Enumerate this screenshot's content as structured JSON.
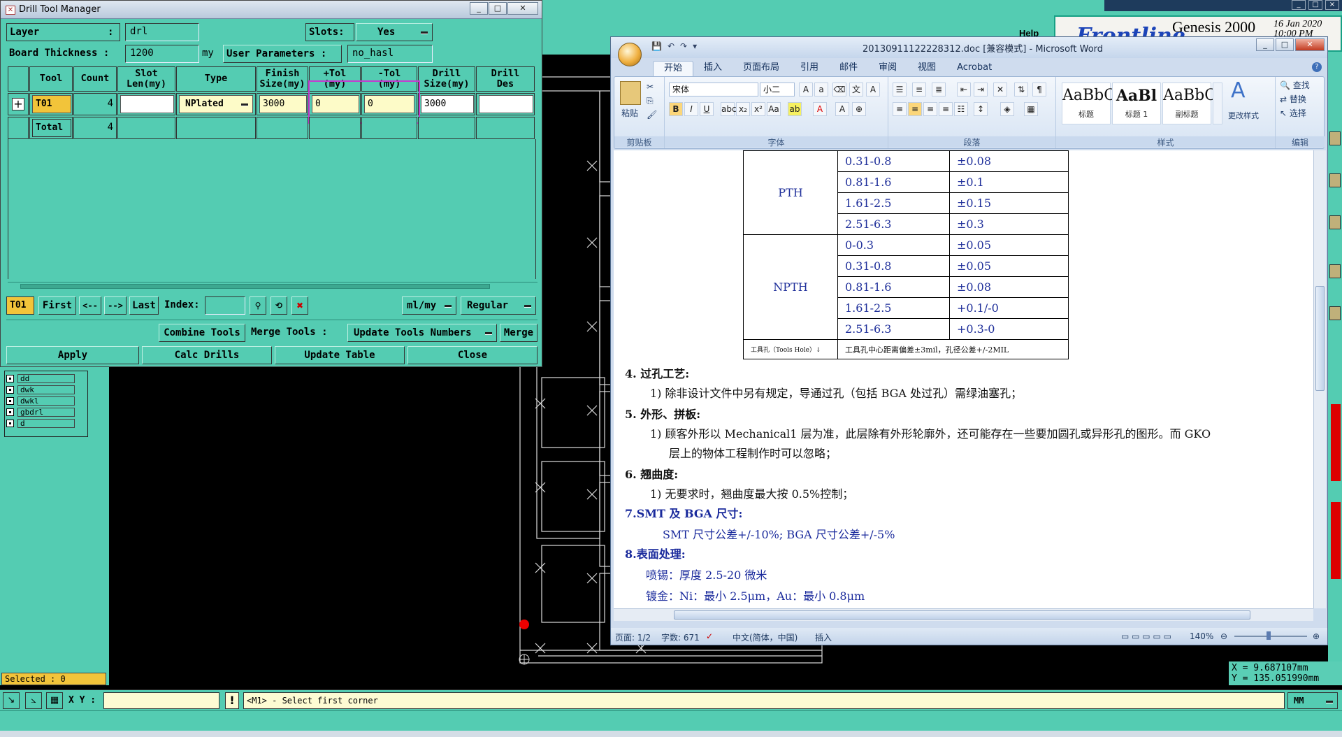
{
  "drill_tool_manager": {
    "title": "Drill Tool Manager",
    "layer_label": "Layer",
    "layer_colon": ":",
    "layer_value": "drl",
    "slots_label": "Slots:",
    "slots_value": "Yes",
    "board_thickness_label": "Board Thickness :",
    "board_thickness_value": "1200",
    "board_thickness_unit": "my",
    "user_params_label": "User Parameters :",
    "user_params_value": "no_hasl",
    "columns": [
      "Tool",
      "Count",
      "Slot\nLen(my)",
      "Type",
      "Finish\nSize(my)",
      "+Tol\n(my)",
      "-Tol\n(my)",
      "Drill\nSize(my)",
      "Drill\nDes"
    ],
    "rows": [
      {
        "tool": "T01",
        "count": "4",
        "slot_len": "",
        "type": "NPlated",
        "finish_size": "3000",
        "plus_tol": "0",
        "minus_tol": "0",
        "drill_size": "3000",
        "drill_des": ""
      }
    ],
    "total_label": "Total",
    "total_count": "4",
    "nav": {
      "current_tool": "T01",
      "first": "First",
      "prev": "<--",
      "next": "-->",
      "last": "Last",
      "index_label": "Index:",
      "unit_select": "ml/my",
      "mode_select": "Regular"
    },
    "actions": {
      "combine_tools": "Combine Tools",
      "merge_tools": "Merge Tools :",
      "update_tools_numbers": "Update Tools Numbers",
      "merge": "Merge",
      "apply": "Apply",
      "calc_drills": "Calc Drills",
      "update_table": "Update Table",
      "close": "Close"
    }
  },
  "genesis": {
    "brand": "Frontline",
    "product": "Genesis 2000",
    "date": "16 Jan 2020",
    "time": "10:00 PM",
    "help": "Help",
    "layers": [
      "dd",
      "dwk",
      "dwkl",
      "gbdrl",
      "d"
    ],
    "selected": "Selected : 0",
    "coord_x": "X = 9.687107mm",
    "coord_y": "Y = 135.051990mm",
    "xy_label": "X Y :",
    "prompt": "<M1> - Select first corner",
    "units": "MM"
  },
  "word": {
    "title": "20130911122228312.doc [兼容模式] - Microsoft Word",
    "tabs": [
      "开始",
      "插入",
      "页面布局",
      "引用",
      "邮件",
      "审阅",
      "视图",
      "Acrobat"
    ],
    "clipboard": {
      "paste": "粘贴",
      "group": "剪贴板"
    },
    "font": {
      "name": "宋体",
      "size": "小二",
      "group": "字体"
    },
    "paragraph_group": "段落",
    "styles": [
      {
        "preview": "AaBbC",
        "name": "标题"
      },
      {
        "preview": "AaBl",
        "name": "标题 1"
      },
      {
        "preview": "AaBbC",
        "name": "副标题"
      }
    ],
    "change_styles": "更改样式",
    "styles_group": "样式",
    "editing": {
      "find": "查找",
      "replace": "替换",
      "select": "选择",
      "group": "编辑"
    },
    "table": {
      "pth_label": "PTH",
      "pth_rows": [
        [
          "0.31-0.8",
          "±0.08"
        ],
        [
          "0.81-1.6",
          "±0.1"
        ],
        [
          "1.61-2.5",
          "±0.15"
        ],
        [
          "2.51-6.3",
          "±0.3"
        ]
      ],
      "npth_label": "NPTH",
      "npth_rows": [
        [
          "0-0.3",
          "±0.05"
        ],
        [
          "0.31-0.8",
          "±0.05"
        ],
        [
          "0.81-1.6",
          "±0.08"
        ],
        [
          "1.61-2.5",
          "+0.1/-0"
        ],
        [
          "2.51-6.3",
          "+0.3-0"
        ]
      ],
      "tool_hole_label": "工具孔（Tools Hole）↓",
      "tool_hole_value": "工具孔中心距离偏差±3mil，孔径公差+/-2MIL"
    },
    "body": [
      "4.   过孔工艺:",
      "1)  除非设计文件中另有规定，导通过孔（包括 BGA 处过孔）需绿油塞孔；",
      "5.   外形、拼板:",
      "1)  顾客外形以 Mechanical1 层为准，此层除有外形轮廓外，还可能存在一些要加圆孔或异形孔的图形。而 GKO",
      "层上的物体工程制作时可以忽略；",
      "6.   翘曲度:",
      "1)  无要求时，翘曲度最大按 0.5%控制；",
      "7.SMT 及 BGA 尺寸:",
      "SMT 尺寸公差+/-10%; BGA 尺寸公差+/-5%",
      "8.表面处理:",
      "喷锡：厚度 2.5-20 微米",
      "镀金：Ni：最小 2.5μm，Au：最小 0.8μm"
    ],
    "status": {
      "page": "页面: 1/2",
      "words": "字数: 671",
      "language": "中文(简体，中国)",
      "mode": "插入",
      "zoom": "140%"
    }
  }
}
